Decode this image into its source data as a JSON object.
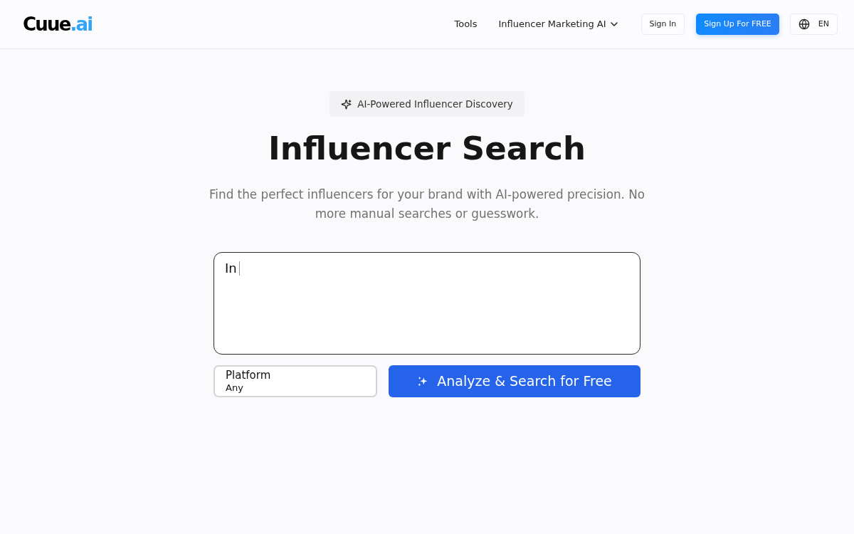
{
  "header": {
    "logo": {
      "name": "Cuue",
      "suffix": ".ai"
    },
    "nav": [
      {
        "label": "Tools",
        "kind": "link"
      },
      {
        "label": "Influencer Marketing AI",
        "kind": "dropdown"
      }
    ],
    "sign_in": "Sign In",
    "sign_up": "Sign Up For FREE",
    "language": "EN"
  },
  "hero": {
    "badge": "AI-Powered Influencer Discovery",
    "title": "Influencer Search",
    "subtitle": "Find the perfect influencers for your brand with AI-powered precision. No more manual searches or guesswork."
  },
  "search": {
    "query": {
      "value": "In",
      "focused": true
    },
    "platform": {
      "label": "Platform",
      "value": "Any"
    },
    "submit": "Analyze & Search for Free"
  }
}
